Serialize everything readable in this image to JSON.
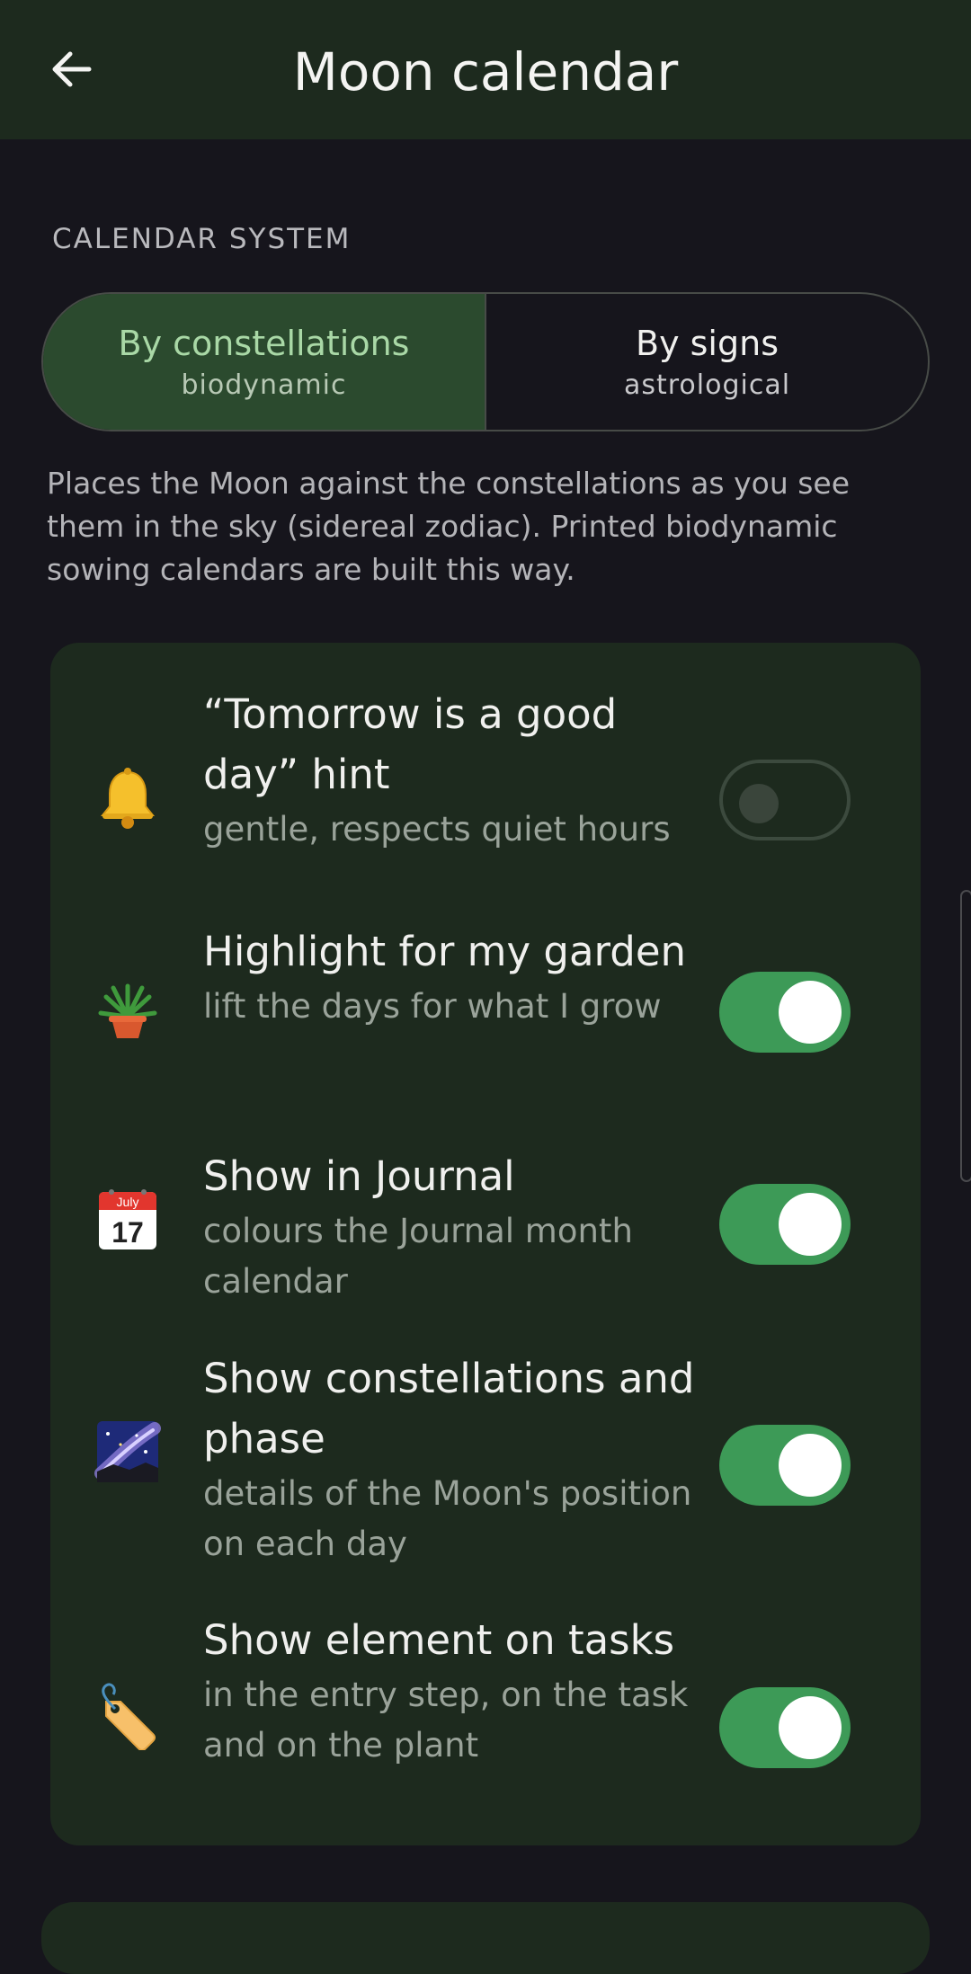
{
  "header": {
    "title": "Moon calendar",
    "back_icon": "arrow-left-icon"
  },
  "calendar_system": {
    "section_label": "CALENDAR SYSTEM",
    "options": [
      {
        "title": "By constellations",
        "subtitle": "biodynamic",
        "selected": true
      },
      {
        "title": "By signs",
        "subtitle": "astrological",
        "selected": false
      }
    ],
    "description": "Places the Moon against the constellations as you see them in the sky (sidereal zodiac). Printed biodynamic sowing calendars are built this way."
  },
  "settings": [
    {
      "icon": "bell-icon",
      "title": "“Tomorrow is a good day” hint",
      "subtitle": "gentle, respects quiet hours",
      "enabled": false
    },
    {
      "icon": "potted-plant-icon",
      "title": "Highlight for my garden",
      "subtitle": "lift the days for what I grow",
      "enabled": true
    },
    {
      "icon": "calendar-icon",
      "title": "Show in Journal",
      "subtitle": "colours the Journal month calendar",
      "enabled": true
    },
    {
      "icon": "milky-way-icon",
      "title": "Show constellations and phase",
      "subtitle": "details of the Moon's position on each day",
      "enabled": true
    },
    {
      "icon": "tag-icon",
      "title": "Show element on tasks",
      "subtitle": "in the entry step, on the task and on the plant",
      "enabled": true
    }
  ],
  "calendar_icon_text": {
    "month": "July",
    "day": "17"
  },
  "colors": {
    "background": "#16151c",
    "card": "#1d2a1e",
    "selected_segment": "#2b4a2e",
    "toggle_on": "#3d9a57"
  }
}
